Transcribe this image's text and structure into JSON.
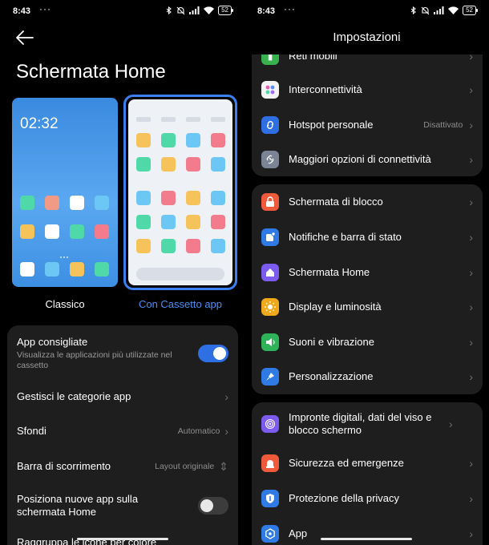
{
  "status": {
    "time": "8:43",
    "dots": "···",
    "battery": "52"
  },
  "left": {
    "title": "Schermata Home",
    "previews": {
      "classic": {
        "label": "Classico",
        "clock": "02:32"
      },
      "drawer": {
        "label": "Con Cassetto app"
      }
    },
    "settings": [
      {
        "title": "App consigliate",
        "subtitle": "Visualizza le applicazioni più utilizzate nel cassetto",
        "toggle": "on"
      },
      {
        "title": "Gestisci le categorie app"
      },
      {
        "title": "Sfondi",
        "value": "Automatico"
      },
      {
        "title": "Barra di scorrimento",
        "value": "Layout originale"
      },
      {
        "title": "Posiziona nuove app sulla schermata Home",
        "toggle": "off"
      },
      {
        "title": "Raggruppa le icone per colore"
      }
    ]
  },
  "right": {
    "title": "Impostazioni",
    "group1": [
      {
        "label": "Reti mobili"
      },
      {
        "label": "Interconnettività"
      },
      {
        "label": "Hotspot personale",
        "value": "Disattivato"
      },
      {
        "label": "Maggiori opzioni di connettività"
      }
    ],
    "group2": [
      {
        "label": "Schermata di blocco"
      },
      {
        "label": "Notifiche e barra di stato"
      },
      {
        "label": "Schermata Home"
      },
      {
        "label": "Display e luminosità"
      },
      {
        "label": "Suoni e vibrazione"
      },
      {
        "label": "Personalizzazione"
      }
    ],
    "group3": [
      {
        "label": "Impronte digitali, dati del viso e blocco schermo"
      },
      {
        "label": "Sicurezza ed emergenze"
      },
      {
        "label": "Protezione della privacy"
      },
      {
        "label": "App"
      }
    ]
  },
  "icons": {
    "reti": "cellular-icon",
    "inter": "interconnect-icon",
    "hotspot": "hotspot-icon",
    "more": "link-icon",
    "lock": "lock-icon",
    "notif": "notification-icon",
    "home": "home-icon",
    "display": "sun-icon",
    "sound": "speaker-icon",
    "custom": "brush-icon",
    "finger": "fingerprint-icon",
    "safety": "emergency-icon",
    "privacy": "shield-icon",
    "apps": "apps-icon"
  }
}
